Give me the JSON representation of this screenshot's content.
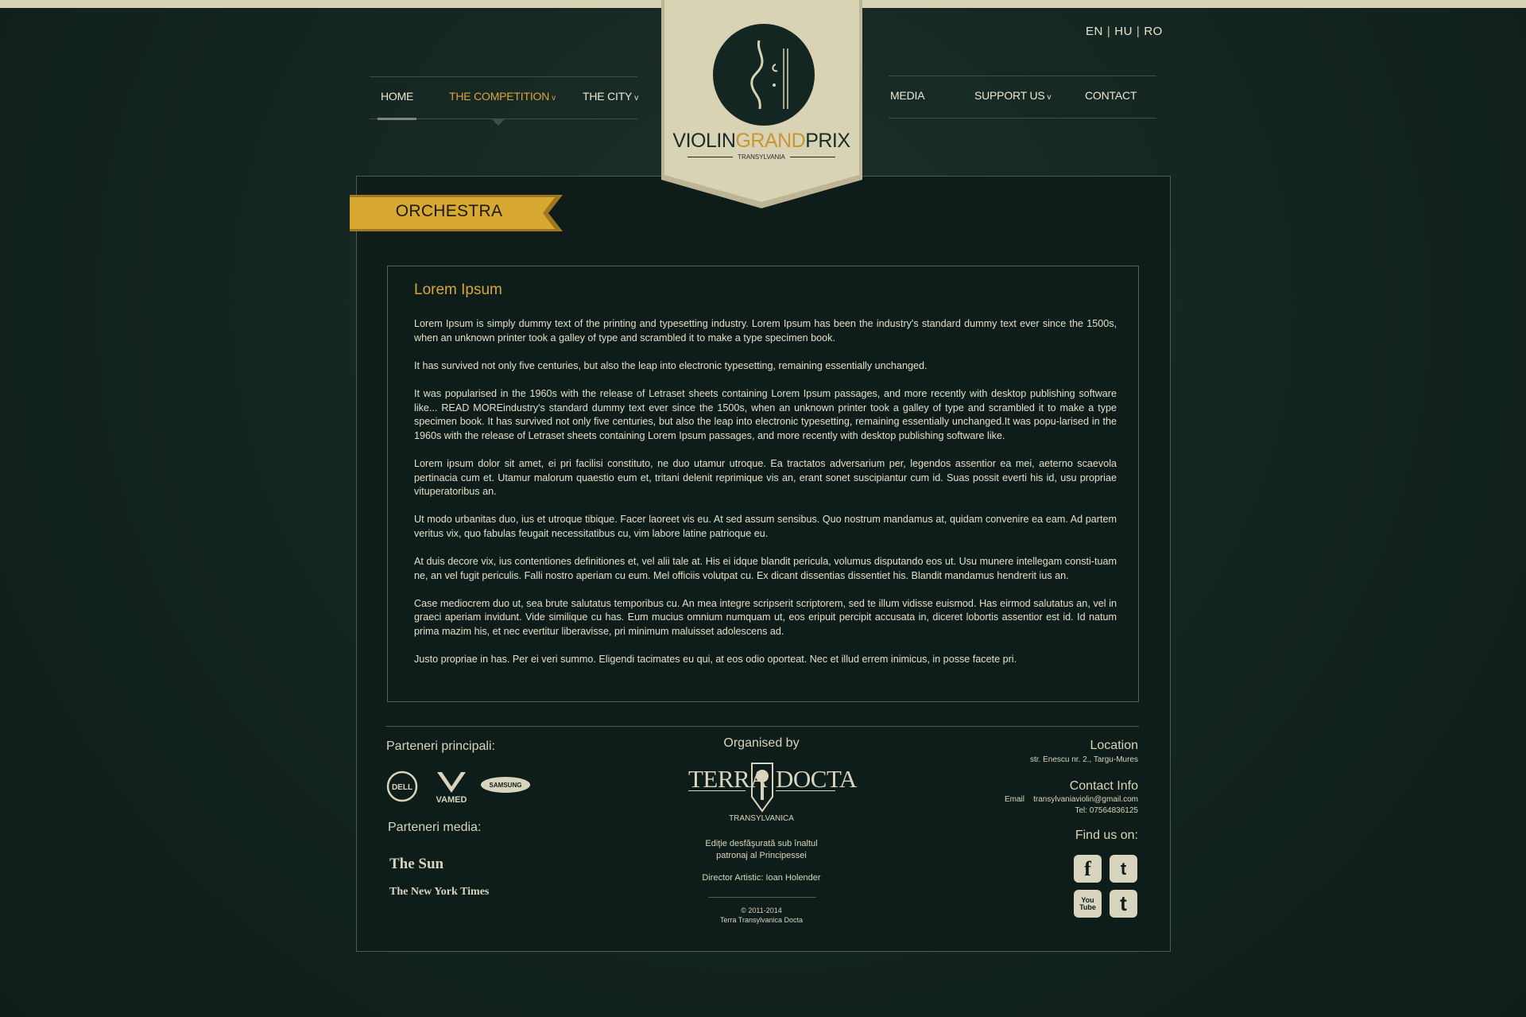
{
  "languages": [
    "EN",
    "HU",
    "RO"
  ],
  "nav_left": [
    {
      "label": "HOME"
    },
    {
      "label": "THE COMPETITION",
      "dropdown": "v"
    },
    {
      "label": "THE CITY",
      "dropdown": "v"
    }
  ],
  "nav_right": [
    {
      "label": "MEDIA"
    },
    {
      "label": "SUPPORT US",
      "dropdown": "v"
    },
    {
      "label": "CONTACT"
    }
  ],
  "logo": {
    "word1": "VIOLIN",
    "word2": "GRAND",
    "word3": "PRIX",
    "sub": "TRANSYLVANIA"
  },
  "section_title": "ORCHESTRA",
  "content": {
    "title": "Lorem Ipsum",
    "paragraphs": [
      "Lorem Ipsum is simply dummy text of the printing and typesetting industry. Lorem Ipsum has been the industry's standard dummy text ever since the 1500s, when an unknown printer took a galley of type and scrambled it to make a type specimen book.",
      "It has survived not only five centuries, but also the leap into electronic typesetting, remaining essentially unchanged.",
      "It was popularised in the 1960s with the release of Letraset sheets containing Lorem Ipsum passages, and more recently with desktop publishing software like... READ MOREindustry's standard dummy text ever since the 1500s, when an unknown printer took a galley of type and scrambled it to make a type specimen book. It has survived not only five centuries, but also the leap into electronic typesetting, remaining essentially unchanged.It was popu-larised in the 1960s with the release of Letraset sheets containing Lorem Ipsum passages, and more recently with desktop publishing software like.",
      "Lorem ipsum dolor sit amet, ei pri facilisi constituto, ne duo utamur utroque. Ea tractatos adversarium per, legendos assentior ea mei, aeterno scaevola pertinacia cum et. Utamur malorum quaestio eum et, tritani delenit reprimique vis an, erant sonet suscipiantur cum id. Suas possit everti his id, usu propriae vituperatoribus an.",
      "Ut modo urbanitas duo, ius et utroque tibique. Facer laoreet vis eu. At sed assum sensibus. Quo nostrum mandamus at, quidam convenire ea eam. Ad partem veritus vix, quo fabulas feugait necessitatibus cu, vim labore latine patrioque eu.",
      "At duis decore vix, ius contentiones definitiones et, vel alii tale at. His ei idque blandit pericula, volumus disputando eos ut. Usu munere intellegam consti-tuam ne, an vel fugit periculis. Falli nostro aperiam cu eum. Mel officiis volutpat cu. Ex dicant dissentias dissentiet his. Blandit mandamus hendrerit ius an.",
      "Case mediocrem duo ut, sea brute salutatus temporibus cu. An mea integre scripserit scriptorem, sed te illum vidisse euismod. Has eirmod salutatus an, vel in graeci aperiam invidunt. Vide similique cu has. Eum mucius omnium numquam ut, eos eripuit percipit accusata in, diceret lobortis assentior est id. Id natum prima mazim his, et nec evertitur liberavisse, pri minimum maluisset adolescens ad.",
      "Justo propriae in has. Per ei veri summo. Eligendi tacimates eu qui, at eos odio oporteat. Nec et illud errem inimicus, in posse facete pri."
    ]
  },
  "footer": {
    "partners_main_title": "Parteneri principali:",
    "partners_main": [
      "DELL",
      "VAMED",
      "SAMSUNG"
    ],
    "partners_media_title": "Parteneri media:",
    "partners_media": [
      "The Sun",
      "The New York Times"
    ],
    "organised_by": "Organised by",
    "org_terra": "TERRA",
    "org_docta": "DOCTA",
    "org_sub": "TRANSYLVANICA",
    "patronage": "Ediţie desfăşurată sub înaltul patronaj al Principessei",
    "director": "Director Artistic: Ioan Holender",
    "copyright": "© 2011-2014",
    "copyright_owner": "Terra Transylvanica Docta",
    "location_title": "Location",
    "location_address": "str. Enescu nr. 2., Targu-Mures",
    "contact_title": "Contact Info",
    "email_label": "Email",
    "email": "transylvaniaviolin@gmail.com",
    "tel": "Tel: 07564836125",
    "find_us": "Find us on:",
    "social": [
      "f",
      "t",
      "You Tube",
      "t"
    ]
  },
  "colors": {
    "background": "#142622",
    "accent_gold": "#d7a540",
    "banner_cream": "#d9d3b5",
    "ribbon_gold": "#d8a930",
    "text_light": "#e4dfcb"
  }
}
